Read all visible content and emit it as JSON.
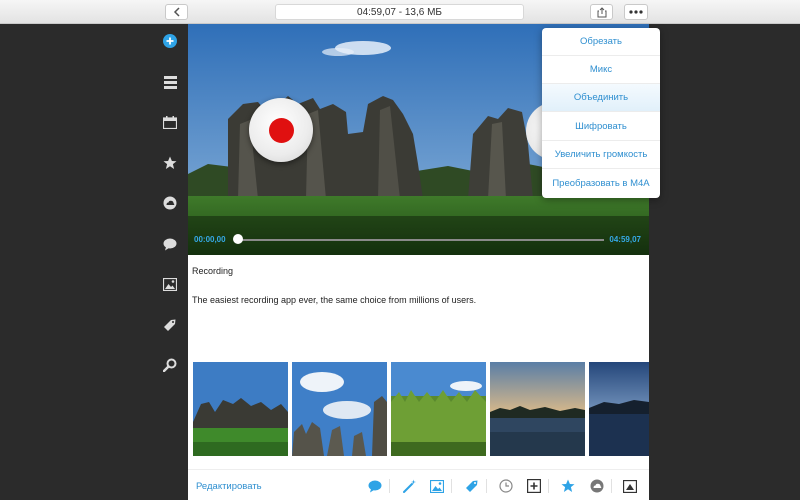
{
  "toolbar": {
    "title": "04:59,07 - 13,6 МБ",
    "back_icon": "chevron-left-icon",
    "share_icon": "share-icon",
    "more_icon": "ellipsis-icon"
  },
  "sidebar": {
    "items": [
      {
        "icon": "add-icon",
        "active": true
      },
      {
        "icon": "list-icon"
      },
      {
        "icon": "calendar-icon"
      },
      {
        "icon": "star-icon"
      },
      {
        "icon": "cloud-icon"
      },
      {
        "icon": "chat-icon"
      },
      {
        "icon": "image-icon"
      },
      {
        "icon": "tag-icon"
      },
      {
        "icon": "search-icon"
      }
    ]
  },
  "player": {
    "current_time": "00:00,00",
    "total_time": "04:59,07",
    "progress": 0
  },
  "menu": {
    "items": [
      {
        "label": "Обрезать"
      },
      {
        "label": "Микс"
      },
      {
        "label": "Объединить",
        "highlighted": true
      },
      {
        "label": "Шифровать"
      },
      {
        "label": "Увеличить громкость"
      },
      {
        "label": "Преобразовать в M4A"
      }
    ]
  },
  "recording": {
    "title": "Recording",
    "description": "The easiest recording app ever, the same choice from millions of users."
  },
  "thumbnails": [
    {
      "subject": "stone forest with lawn"
    },
    {
      "subject": "stone pillars under blue sky"
    },
    {
      "subject": "corn field"
    },
    {
      "subject": "lake at dusk"
    },
    {
      "subject": "lake at night"
    }
  ],
  "bottom_bar": {
    "edit_label": "Редактировать",
    "icons": [
      "chat-icon",
      "magic-wand-icon",
      "image-icon",
      "tag-icon",
      "clock-icon",
      "add-box-icon",
      "star-icon",
      "cloud-icon",
      "image-frame-icon"
    ]
  },
  "colors": {
    "accent": "#2f8fd0",
    "time_accent": "#35a9e6",
    "record": "#e01010",
    "sidebar_bg": "#2b2b2b"
  }
}
